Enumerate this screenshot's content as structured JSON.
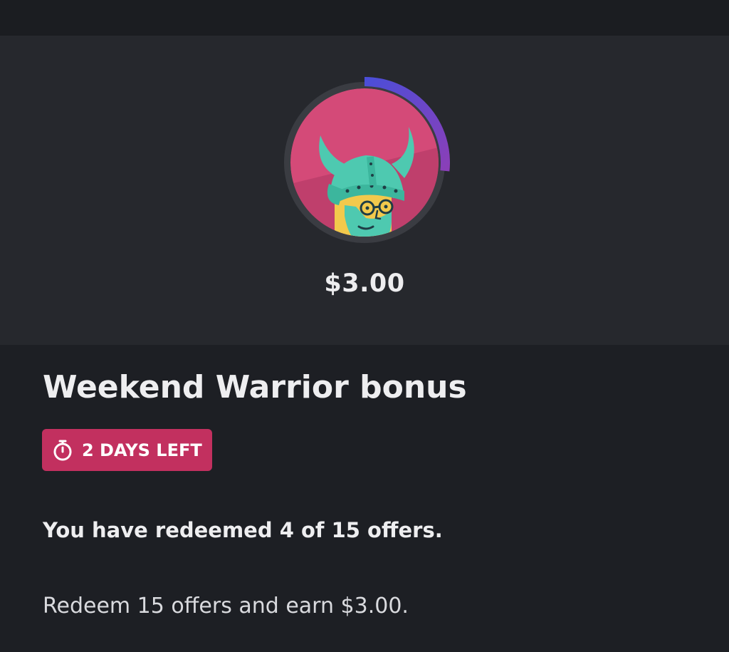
{
  "bonus": {
    "reward_amount": "$3.00",
    "title": "Weekend Warrior bonus",
    "time_left_label": "2 DAYS LEFT",
    "progress_text": "You have redeemed 4 of 15 offers.",
    "description": "Redeem 15 offers and earn $3.00.",
    "offers_redeemed": 4,
    "offers_required": 15,
    "badge_icon": "viking-warrior-avatar",
    "timer_icon": "stopwatch-icon"
  },
  "colors": {
    "progress_start": "#4b4ed8",
    "progress_end": "#8a3fb8",
    "ring_track": "#3a3c42",
    "avatar_background": "#d44a78",
    "time_badge": "#c2305f"
  }
}
